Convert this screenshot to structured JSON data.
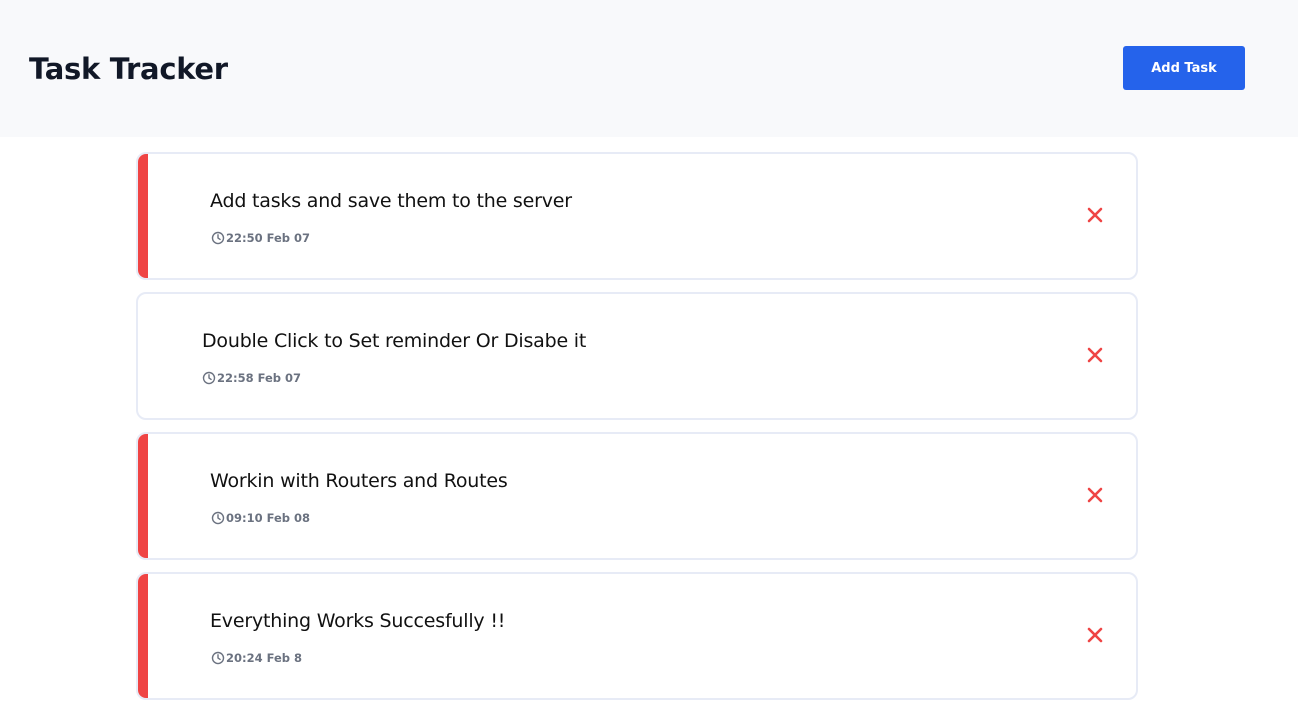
{
  "header": {
    "title": "Task Tracker",
    "add_button_label": "Add Task"
  },
  "colors": {
    "primary": "#2563eb",
    "reminder_accent": "#ef4444",
    "delete_icon": "#ef4444"
  },
  "tasks": [
    {
      "text": "Add tasks and save them to the server",
      "time": "22:50 Feb 07",
      "reminder": true
    },
    {
      "text": "Double Click to Set reminder Or Disabe it",
      "time": "22:58 Feb 07",
      "reminder": false
    },
    {
      "text": "Workin with Routers and Routes",
      "time": "09:10 Feb 08",
      "reminder": true
    },
    {
      "text": "Everything Works Succesfully !!",
      "time": "20:24 Feb 8",
      "reminder": true
    }
  ],
  "icons": {
    "time": "clock-icon",
    "delete": "close-icon"
  }
}
